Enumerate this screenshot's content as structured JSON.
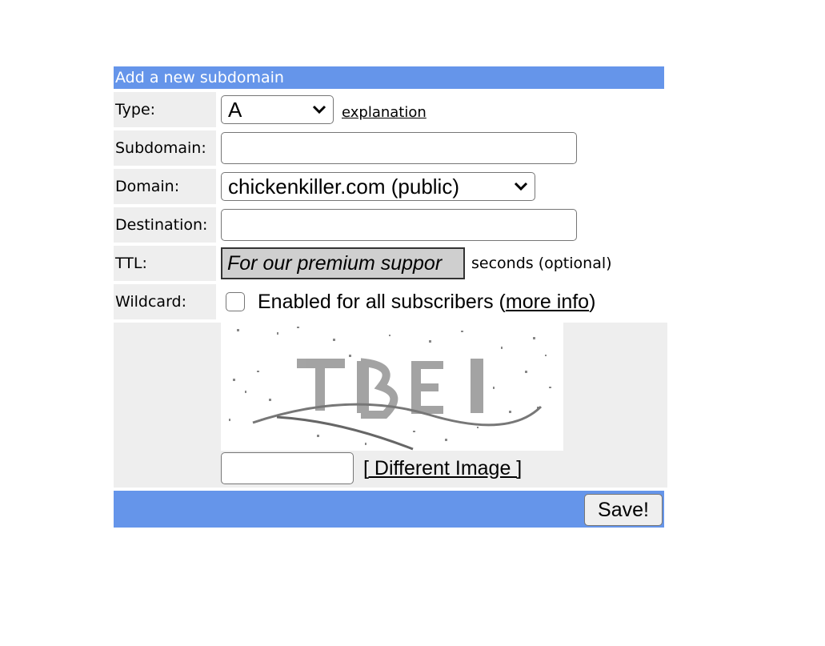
{
  "form": {
    "header_title": "Add a new subdomain",
    "type": {
      "label": "Type:",
      "selected": "A",
      "explanation_link": "explanation"
    },
    "subdomain": {
      "label": "Subdomain:",
      "value": ""
    },
    "domain": {
      "label": "Domain:",
      "selected": "chickenkiller.com (public)"
    },
    "destination": {
      "label": "Destination:",
      "value": ""
    },
    "ttl": {
      "label": "TTL:",
      "value": "For our premium suppor",
      "suffix": "seconds (optional)"
    },
    "wildcard": {
      "label": "Wildcard:",
      "checked": false,
      "text": "Enabled for all subscribers (",
      "more_info_link": "more info",
      "text_end": ")"
    },
    "captcha": {
      "image_text": "TBEI",
      "value": "",
      "different_image_link": "[ Different Image ]"
    },
    "save_label": "Save!"
  },
  "colors": {
    "accent": "#6595ea",
    "label_bg": "#eeeeee"
  },
  "icons": {
    "select_arrow": "chevron-down-icon"
  }
}
